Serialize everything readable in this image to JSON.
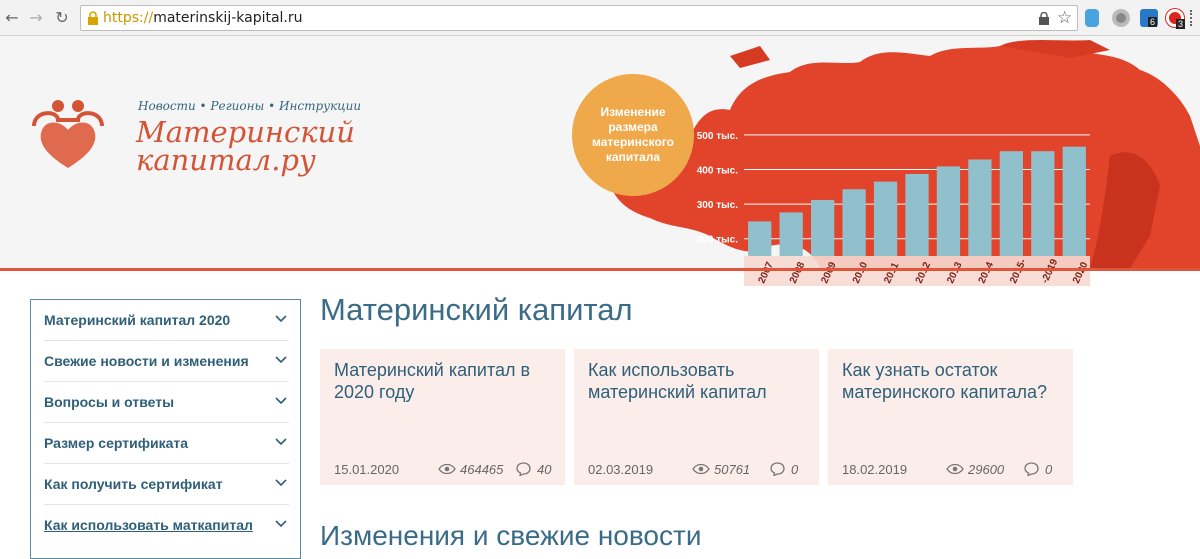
{
  "browser": {
    "url_scheme": "https://",
    "url_host": "materinskij-kapital.ru",
    "back_icon": "arrow-left",
    "forward_icon": "arrow-right",
    "reload_icon": "reload",
    "badge_count_1": "6",
    "badge_count_2": "3"
  },
  "header": {
    "tagline": "Новости • Регионы • Инструкции",
    "logo_line1": "Материнский",
    "logo_line2": "капитал.ру",
    "circle_text": "Изменение размера материнского капитала",
    "accent_color": "#e0563b"
  },
  "chart_data": {
    "type": "bar",
    "categories": [
      "2007",
      "2008",
      "2009",
      "2010",
      "2011",
      "2012",
      "2013",
      "2014",
      "2015-",
      "-2019",
      "2020"
    ],
    "values": [
      250,
      276,
      312,
      343,
      365,
      387,
      409,
      429,
      453,
      453,
      466
    ],
    "ytick_labels": [
      "200 тыс.",
      "300 тыс.",
      "400 тыс.",
      "500 тыс."
    ],
    "yticks": [
      200,
      300,
      400,
      500
    ],
    "ylim": [
      150,
      520
    ],
    "bar_color": "#8fc0cc"
  },
  "sidebar": {
    "items": [
      {
        "label": "Материнский капитал 2020"
      },
      {
        "label": "Свежие новости и изменения"
      },
      {
        "label": "Вопросы и ответы"
      },
      {
        "label": "Размер сертификата"
      },
      {
        "label": "Как получить сертификат"
      },
      {
        "label": "Как использовать маткапитал"
      }
    ]
  },
  "main": {
    "title": "Материнский капитал",
    "cards": [
      {
        "title": "Материнский капитал в 2020 году",
        "date": "15.01.2020",
        "views": "464465",
        "comments": "40"
      },
      {
        "title": "Как использовать материнский капитал",
        "date": "02.03.2019",
        "views": "50761",
        "comments": "0"
      },
      {
        "title": "Как узнать остаток материнского капитала?",
        "date": "18.02.2019",
        "views": "29600",
        "comments": "0"
      }
    ],
    "subtitle": "Изменения и свежие новости"
  }
}
